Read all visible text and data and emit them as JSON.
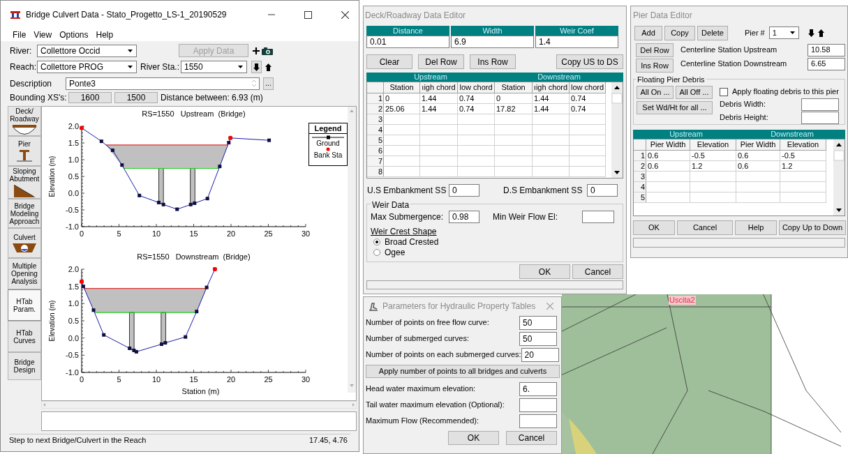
{
  "main_window": {
    "title": "Bridge Culvert Data - Stato_Progetto_LS-1_20190529",
    "menu": [
      "File",
      "View",
      "Options",
      "Help"
    ],
    "river": {
      "label": "River:",
      "value": "Collettore Occid"
    },
    "apply_button": {
      "label": "Apply Data",
      "disabled": true
    },
    "reach": {
      "label": "Reach:",
      "value": "Collettore PROG"
    },
    "river_station": {
      "label": "River Sta.:",
      "value": "1550"
    },
    "description": {
      "label": "Description",
      "value": "Ponte3",
      "button": "..."
    },
    "bounding": {
      "label": "Bounding XS's:",
      "upstream": "1600",
      "downstream": "1500",
      "distance": "Distance between: 6.93 (m)"
    },
    "editor_tabs": [
      {
        "label": "Deck/ Roadway",
        "kind": "deck",
        "selected": false
      },
      {
        "label": "Pier",
        "kind": "pier",
        "selected": false
      },
      {
        "label": "Sloping Abutment",
        "kind": "abutment",
        "selected": false
      },
      {
        "label": "Bridge Modeling Approach",
        "kind": "text",
        "selected": false
      },
      {
        "label": "Culvert",
        "kind": "culvert",
        "selected": false
      },
      {
        "label": "Multiple Opening Analysis",
        "kind": "text",
        "selected": false
      },
      {
        "label": "HTab Param.",
        "kind": "text",
        "selected": true
      },
      {
        "label": "HTab Curves",
        "kind": "text",
        "selected": false
      },
      {
        "label": "Bridge Design",
        "kind": "text",
        "selected": false
      }
    ],
    "charts": [
      {
        "chart_data": {
          "type": "line",
          "title": "RS=1550   Upstream  (Bridge)",
          "ylabel": "Elevation (m)",
          "x": [
            0,
            2.65,
            4.15,
            5.4,
            7.73,
            10.32,
            10.95,
            12.78,
            14.6,
            15.12,
            16.84,
            18.49,
            19.7,
            19.92,
            25.1
          ],
          "series": [
            {
              "color": "#1a1aa8",
              "marker": "square",
              "values": [
                1.95,
                1.55,
                1.28,
                0.84,
                -0.07,
                -0.28,
                -0.34,
                -0.48,
                -0.34,
                -0.3,
                -0.16,
                0.8,
                1.51,
                1.65,
                1.58
              ]
            }
          ],
          "ref_lines": [
            {
              "axis": "y",
              "value": 1.44,
              "color": "#e03030"
            },
            {
              "axis": "y",
              "value": 0.74,
              "color": "#20d020"
            }
          ],
          "xlim": [
            0,
            30
          ],
          "ylim": [
            -1,
            2
          ],
          "xticks": [
            0,
            5,
            10,
            15,
            20,
            25,
            30
          ],
          "yticks": [
            {
              "value": 2,
              "label": "2.0"
            },
            {
              "value": 1.5,
              "label": "1.5"
            },
            {
              "value": 1,
              "label": "1.0"
            },
            {
              "value": 0.5,
              "label": "0.5"
            },
            {
              "value": 0,
              "label": "0.0"
            },
            {
              "value": -0.5,
              "label": "-0.5"
            },
            {
              "value": -1,
              "label": "-1.0"
            }
          ]
        }
      },
      {
        "chart_data": {
          "type": "line",
          "title": "RS=1550   Downstream  (Bridge)",
          "xlabel": "Station (m)",
          "ylabel": "Elevation (m)",
          "x": [
            0,
            0.22,
            1.59,
            2.96,
            6.42,
            7.0,
            7.33,
            10.7,
            11.2,
            13.9,
            15.4,
            16.74,
            17.84
          ],
          "series": [
            {
              "color": "#1a1aa8",
              "marker": "square",
              "values": [
                1.64,
                1.5,
                0.81,
                0.09,
                -0.3,
                -0.36,
                -0.4,
                -0.18,
                -0.14,
                0.03,
                0.77,
                1.47,
                2.0
              ]
            }
          ],
          "ref_lines": [
            {
              "axis": "y",
              "value": 1.44,
              "color": "#e03030"
            },
            {
              "axis": "y",
              "value": 0.74,
              "color": "#20d020"
            }
          ],
          "xlim": [
            0,
            30
          ],
          "ylim": [
            -1,
            2
          ],
          "xticks": [
            0,
            5,
            10,
            15,
            20,
            25,
            30
          ],
          "yticks": [
            {
              "value": 2,
              "label": "2.0"
            },
            {
              "value": 1.5,
              "label": "1.5"
            },
            {
              "value": 1,
              "label": "1.0"
            },
            {
              "value": 0.5,
              "label": "0.5"
            },
            {
              "value": 0,
              "label": "0.0"
            },
            {
              "value": -0.5,
              "label": "-0.5"
            },
            {
              "value": -1,
              "label": "-1.0"
            }
          ]
        }
      }
    ],
    "legend": {
      "title": "Legend",
      "items": [
        {
          "label": "Ground",
          "kind": "line-square"
        },
        {
          "label": "Bank Sta",
          "kind": "dot"
        }
      ]
    },
    "status_bar": {
      "message": "Step to next Bridge/Culvert in the Reach",
      "coordinates": "17.45, 4.76"
    }
  },
  "deck_editor": {
    "title": "Deck/Roadway Data Editor",
    "fields": [
      {
        "label": "Distance",
        "value": "0.01"
      },
      {
        "label": "Width",
        "value": "6.9"
      },
      {
        "label": "Weir Coef",
        "value": "1.4"
      }
    ],
    "buttons": [
      "Clear",
      "Del Row",
      "Ins Row",
      "Copy US to DS"
    ],
    "table": {
      "groups": [
        "Upstream",
        "Downstream"
      ],
      "columns": [
        "Station",
        "ıigh chord",
        "low chord",
        "Station",
        "ıigh chord",
        "low chord"
      ],
      "rows": [
        {
          "number": "1",
          "cells": [
            "0",
            "1.44",
            "0.74",
            "0",
            "1.44",
            "0.74"
          ]
        },
        {
          "number": "2",
          "cells": [
            "25.06",
            "1.44",
            "0.74",
            "17.82",
            "1.44",
            "0.74"
          ]
        },
        {
          "number": "3"
        },
        {
          "number": "4"
        },
        {
          "number": "5"
        },
        {
          "number": "6"
        },
        {
          "number": "7"
        },
        {
          "number": "8"
        }
      ]
    },
    "us_embankment": {
      "label": "U.S Embankment SS",
      "value": "0"
    },
    "ds_embankment": {
      "label": "D.S Embankment SS",
      "value": "0"
    },
    "weir_data": {
      "title": "Weir Data",
      "max_submergence": {
        "label": "Max  Submergence:",
        "value": "0.98"
      },
      "min_weir_flow": {
        "label": "Min Weir Flow El:"
      },
      "crest_shape": {
        "label": "Weir Crest Shape",
        "options": [
          {
            "label": "Broad Crested",
            "selected": true
          },
          {
            "label": "Ogee",
            "selected": false
          }
        ]
      }
    },
    "ok": "OK",
    "cancel": "Cancel"
  },
  "pier_editor": {
    "title": "Pier Data Editor",
    "buttons": [
      "Add",
      "Copy",
      "Delete"
    ],
    "pier_label": "Pier #",
    "pier_value": "1",
    "row_buttons": [
      "Del Row",
      "Ins Row"
    ],
    "centerline_upstream": {
      "label": "Centerline Station Upstream",
      "value": "10.58"
    },
    "centerline_downstream": {
      "label": "Centerline Station Downstream",
      "value": "6.65"
    },
    "debris": {
      "title": "Floating Pier Debris",
      "all_on": "All On ...",
      "all_off": "All Off ...",
      "set_all": "Set Wd/Ht for all ...",
      "apply": {
        "label": "Apply floating debris to this pier",
        "checked": false
      },
      "width_label": "Debris Width:",
      "height_label": "Debris Height:"
    },
    "table": {
      "groups": [
        "Upstream",
        "Downstream"
      ],
      "columns": [
        "Pier Width",
        "Elevation",
        "Pier Width",
        "Elevation"
      ],
      "rows": [
        {
          "number": "1",
          "cells": [
            "0.6",
            "-0.5",
            "0.6",
            "-0.5"
          ]
        },
        {
          "number": "2",
          "cells": [
            "0.6",
            "1.2",
            "0.6",
            "1.2"
          ]
        },
        {
          "number": "3"
        },
        {
          "number": "4"
        },
        {
          "number": "5"
        }
      ]
    },
    "footer_buttons": [
      "OK",
      "Cancel",
      "Help",
      "Copy Up to Down"
    ]
  },
  "htab_dialog": {
    "title": "Parameters for Hydraulic Property Tables",
    "fields_top": [
      {
        "label": "Number of points on free flow curve:",
        "value": "50"
      },
      {
        "label": "Number of submerged curves:",
        "value": "50"
      },
      {
        "label": "Number of points on each submerged curves:",
        "value": "20"
      }
    ],
    "apply_button": "Apply number of points to all bridges and culverts",
    "fields_bottom": [
      {
        "label": "Head water maximum elevation:",
        "value": "6."
      },
      {
        "label": "Tail water maximum elevation (Optional):"
      },
      {
        "label": "Maximum Flow (Recommended):"
      }
    ],
    "ok": "OK",
    "cancel": "Cancel"
  },
  "map": {
    "label": "Uscita2"
  }
}
